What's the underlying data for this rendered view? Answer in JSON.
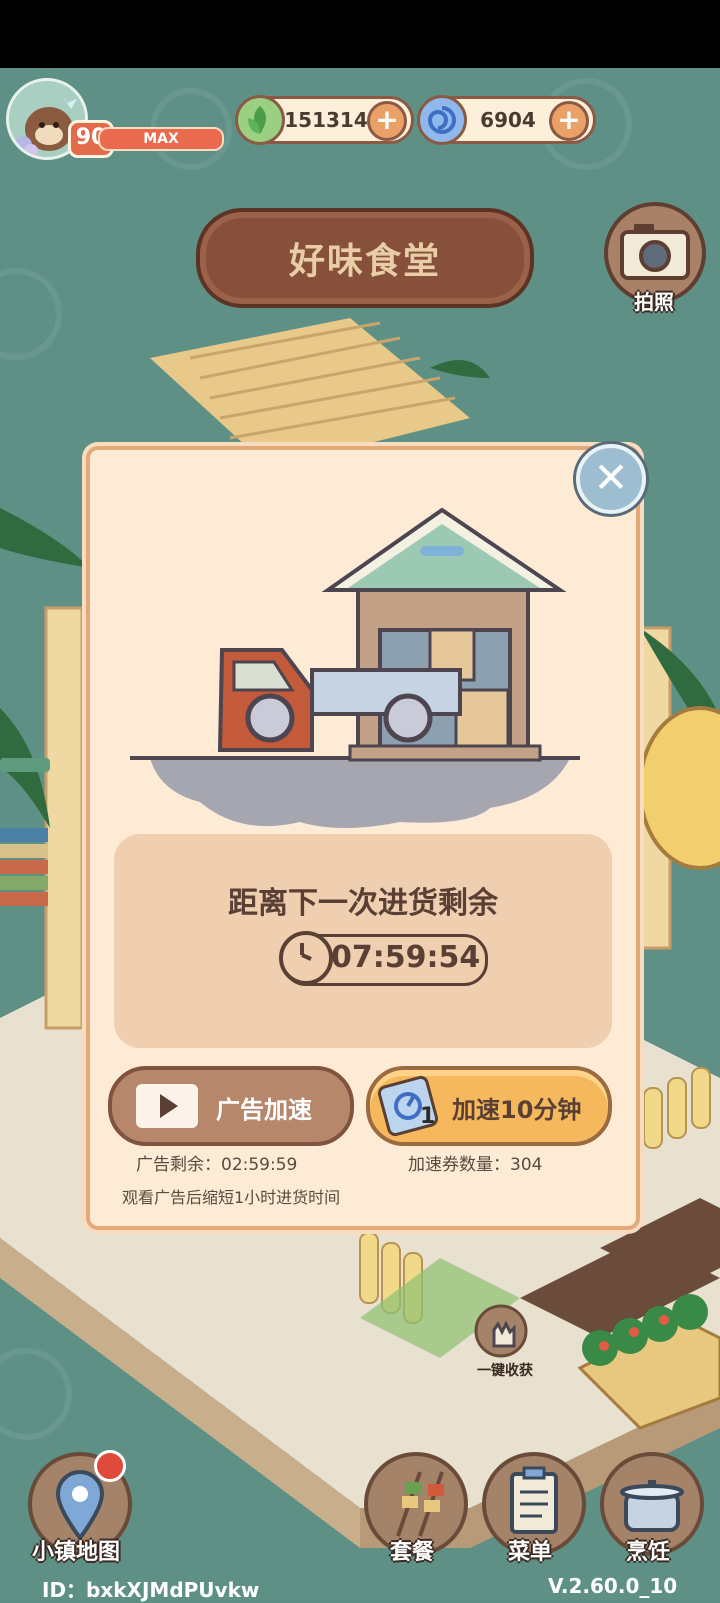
{
  "player": {
    "level": "90",
    "level_status": "MAX"
  },
  "resources": {
    "leaf": {
      "value": "151314",
      "icon": "leaf-icon"
    },
    "swirl": {
      "value": "6904",
      "icon": "swirl-icon"
    }
  },
  "shop_sign": "好味食堂",
  "camera_label": "拍照",
  "dialog": {
    "countdown_title": "距离下一次进货剩余",
    "countdown_time": "07:59:54",
    "ad_button_label": "广告加速",
    "ad_remaining": "广告剩余：02:59:59",
    "ad_hint": "观看广告后缩短1小时进货时间",
    "speed_button_label": "加速10分钟",
    "ticket_count_badge": "1",
    "ticket_count": "加速券数量：304"
  },
  "harvest_label": "一键收获",
  "nav": {
    "map": "小镇地图",
    "set_meal": "套餐",
    "menu": "菜单",
    "cooking": "烹饪"
  },
  "footer": {
    "id": "ID：bxkXJMdPUvkw",
    "version": "V.2.60.0_10"
  }
}
